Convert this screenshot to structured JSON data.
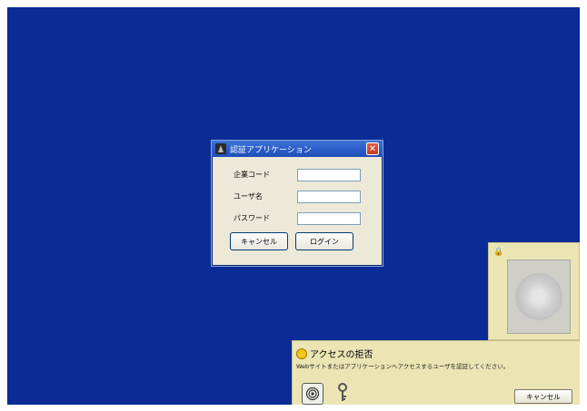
{
  "dialog": {
    "title": "認証アプリケーション",
    "close_glyph": "✕",
    "fields": [
      {
        "label": "企業コード",
        "value": ""
      },
      {
        "label": "ユーザ名",
        "value": ""
      },
      {
        "label": "パスワード",
        "value": ""
      }
    ],
    "cancel_label": "キャンセル",
    "login_label": "ログイン"
  },
  "side_panel": {
    "lock_glyph": "🔒"
  },
  "access_panel": {
    "heading": "アクセスの拒否",
    "description": "Webサイトまたはアプリケーションへアクセスするユーザを認証してください。",
    "cancel_label": "キャンセル"
  },
  "colors": {
    "desktop": "#0b2b96",
    "titlebar": "#2a5bc7",
    "panel": "#eae5b3"
  }
}
